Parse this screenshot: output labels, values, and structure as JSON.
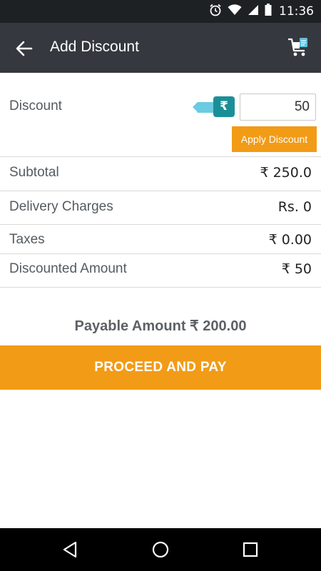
{
  "status_bar": {
    "time": "11:36"
  },
  "app_bar": {
    "title": "Add Discount"
  },
  "discount": {
    "label": "Discount",
    "currency_symbol": "₹",
    "input_value": "50",
    "apply_label": "Apply Discount"
  },
  "summary": {
    "subtotal_label": "Subtotal",
    "subtotal_value": "₹ 250.0",
    "delivery_label": "Delivery Charges",
    "delivery_value": "Rs. 0",
    "taxes_label": "Taxes",
    "taxes_value": "₹ 0.00",
    "discounted_label": "Discounted Amount",
    "discounted_value": "₹ 50"
  },
  "payable_text": "Payable Amount ₹ 200.00",
  "proceed_label": "PROCEED AND PAY",
  "colors": {
    "accent": "#f29b16",
    "toggle": "#1b8f97",
    "app_bar": "#35393f"
  }
}
